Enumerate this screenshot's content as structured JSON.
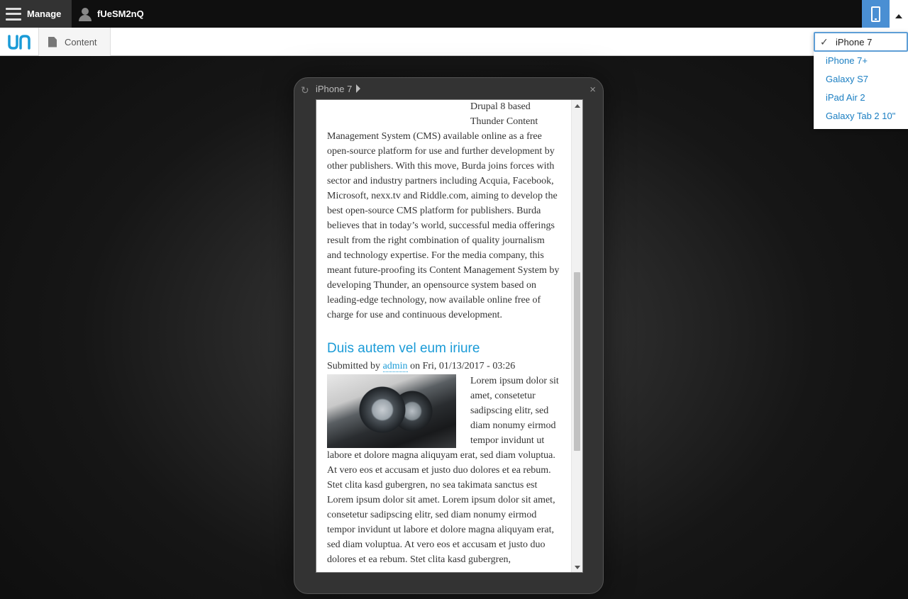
{
  "topbar": {
    "manage_label": "Manage",
    "username": "fUeSM2nQ"
  },
  "toolbar2": {
    "content_label": "Content"
  },
  "device_menu": {
    "selected": "iPhone 7",
    "options": [
      "iPhone 7+",
      "Galaxy S7",
      "iPad Air 2",
      "Galaxy Tab 2 10\""
    ]
  },
  "device_frame": {
    "name": "iPhone 7",
    "close": "×",
    "rotate": "↻"
  },
  "preview": {
    "intro_indented": [
      "Drupal 8 based",
      "Thunder Content"
    ],
    "intro_body": "Management System (CMS) available online as a free open-source platform for use and further development by other publishers. With this move, Burda joins forces with sector and industry partners including Acquia, Facebook, Microsoft, nexx.tv and Riddle.com, aiming to develop the best open-source CMS platform for publishers. Burda believes that in today’s world, successful media offerings result from the right combination of quality journalism and technology expertise. For the media company, this meant future-proofing its Content Management System by developing Thunder, an opensource system based on leading-edge technology, now available online free of charge for use and continuous development.",
    "article": {
      "title": "Duis autem vel eum iriure",
      "submitted_prefix": "Submitted by",
      "author": "admin",
      "submitted_suffix": "on Fri, 01/13/2017 - 03:26",
      "body": "Lorem ipsum dolor sit amet, consetetur sadipscing elitr, sed diam nonumy eirmod tempor invidunt ut labore et dolore magna aliquyam erat, sed diam voluptua. At vero eos et accusam et justo duo dolores et ea rebum. Stet clita kasd gubergren, no sea takimata sanctus est Lorem ipsum dolor sit amet. Lorem ipsum dolor sit amet, consetetur sadipscing elitr, sed diam nonumy eirmod tempor invidunt ut labore et dolore magna aliquyam erat, sed diam voluptua. At vero eos et accusam et justo duo dolores et ea rebum. Stet clita kasd gubergren,"
    }
  },
  "colors": {
    "accent": "#4a8fd3",
    "link": "#1a9bd7"
  },
  "icons": {
    "menu": "hamburger-icon",
    "user": "user-icon",
    "device": "mobile-phone-icon",
    "caret": "caret-up-icon",
    "logo": "thunder-logo-icon",
    "content": "document-icon",
    "check": "checkmark-icon"
  }
}
